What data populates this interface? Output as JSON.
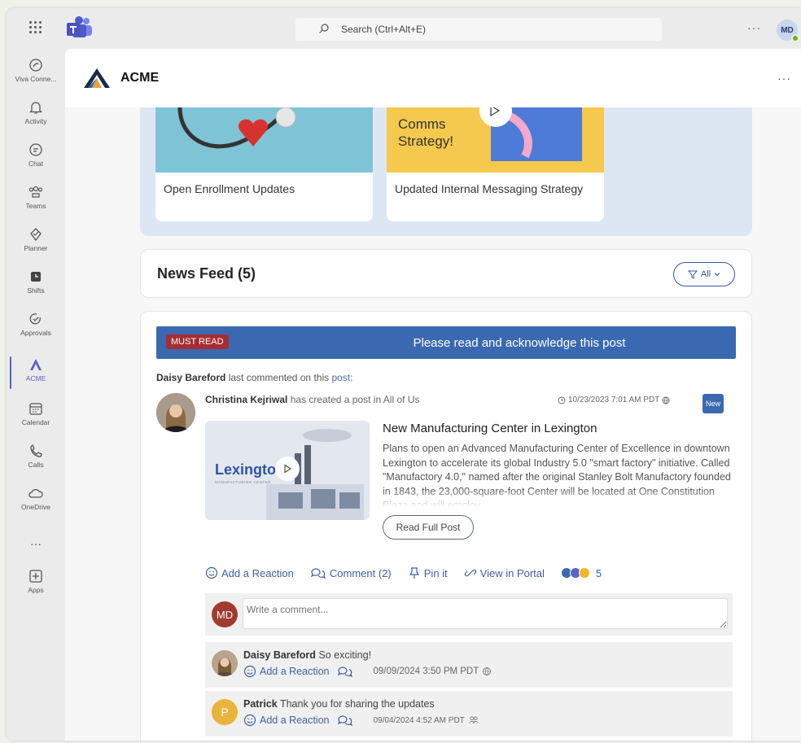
{
  "topbar": {
    "search_placeholder": "Search (Ctrl+Alt+E)",
    "more": "···",
    "user_initials": "MD"
  },
  "rail": [
    {
      "label": "Viva Conne...",
      "icon": "viva-connections-icon"
    },
    {
      "label": "Activity",
      "icon": "bell-icon"
    },
    {
      "label": "Chat",
      "icon": "chat-icon"
    },
    {
      "label": "Teams",
      "icon": "teams-icon"
    },
    {
      "label": "Planner",
      "icon": "planner-icon"
    },
    {
      "label": "Shifts",
      "icon": "shifts-icon"
    },
    {
      "label": "Approvals",
      "icon": "approvals-icon"
    },
    {
      "label": "ACME",
      "icon": "acme-icon",
      "active": true
    },
    {
      "label": "Calendar",
      "icon": "calendar-icon"
    },
    {
      "label": "Calls",
      "icon": "phone-icon"
    },
    {
      "label": "OneDrive",
      "icon": "cloud-icon"
    },
    {
      "label": "···",
      "icon": "more-icon"
    },
    {
      "label": "Apps",
      "icon": "add-app-icon"
    }
  ],
  "app": {
    "title": "ACME",
    "more": "···"
  },
  "banner_cards": [
    {
      "title": "Open Enrollment Updates",
      "image_text": ""
    },
    {
      "title": "Updated Internal Messaging Strategy",
      "image_text": "Comms Strategy!"
    }
  ],
  "feed": {
    "title": "News Feed (5)",
    "filter_label": "All"
  },
  "post": {
    "must_read_tag": "MUST READ",
    "must_read_message": "Please read and acknowledge this post",
    "last_commenter": "Daisy Bareford",
    "last_commented_text": "last commented on this",
    "last_commented_link": "post:",
    "author": "Christina Kejriwal",
    "author_action": "has created a post in All of Us",
    "date": "10/23/2023 7:01 AM PDT",
    "badge": "New",
    "thumb_text": "Lexington",
    "thumb_subtext": "MANUFACTURING CENTER",
    "title": "New Manufacturing Center in Lexington",
    "body": "Plans to open an Advanced Manufacturing Center of Excellence in downtown Lexington to accelerate its global Industry 5.0 \"smart factory\" initiative. Called \"Manufactory 4.0,\" named after the original Stanley Bolt Manufactory founded in 1843, the 23,000-square-foot Center will be located at One Constitution Plaza and will employ",
    "read_full": "Read Full Post",
    "actions": {
      "reaction": "Add a Reaction",
      "comment": "Comment (2)",
      "pin": "Pin it",
      "portal": "View in Portal",
      "reaction_count": "5"
    },
    "comment_input": {
      "avatar_initials": "MD",
      "placeholder": "Write a comment..."
    },
    "comments": [
      {
        "name": "Daisy Bareford",
        "text": "So exciting!",
        "reaction": "Add a Reaction",
        "date": "09/09/2024 3:50 PM PDT"
      },
      {
        "name": "Patrick",
        "initial": "P",
        "text": "Thank you for sharing the updates",
        "reaction": "Add a Reaction",
        "date": "09/04/2024 4:52 AM PDT"
      }
    ]
  },
  "colors": {
    "accent": "#3b69b1",
    "must_read_tag": "#a72d32",
    "teams_purple": "#5b5fc7",
    "link": "#3d5fa5"
  }
}
